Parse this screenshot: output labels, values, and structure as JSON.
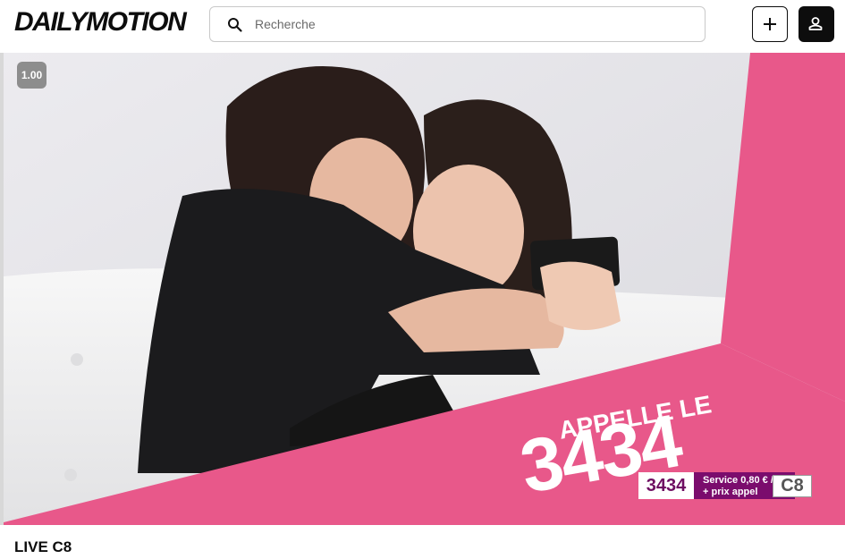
{
  "header": {
    "logo": "DAILYMOTION",
    "search": {
      "placeholder": "Recherche",
      "value": ""
    },
    "add_button_icon": "plus-icon",
    "account_button_icon": "user-icon"
  },
  "player": {
    "playback_rate": "1.00",
    "promo": {
      "heading": "APPELLE LE",
      "number": "3434",
      "badge_number": "3434",
      "service_line1": "Service 0,80 € / min",
      "service_line2": "+ prix appel",
      "channel_logo": "C8"
    },
    "colors": {
      "banner": "#e8588a",
      "badge_purple": "#7b0c6d"
    }
  },
  "video_title": "LIVE C8"
}
